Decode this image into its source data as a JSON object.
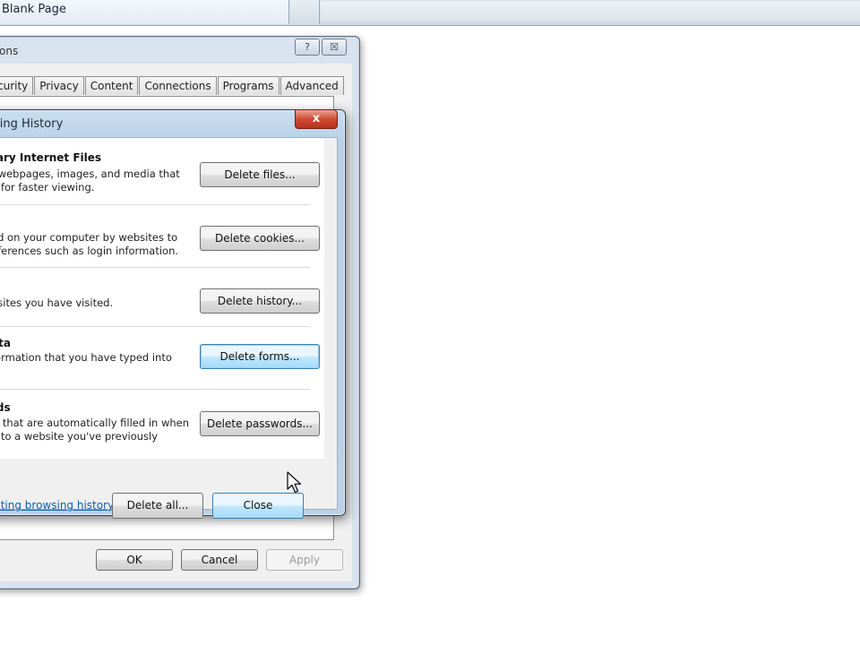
{
  "browser": {
    "active_tab_title": "Blank Page"
  },
  "internet_options": {
    "title": "ons",
    "help_button": "?",
    "close_button": "☒",
    "tabs": [
      "curity",
      "Privacy",
      "Content",
      "Connections",
      "Programs",
      "Advanced"
    ],
    "buttons": {
      "ok": "OK",
      "cancel": "Cancel",
      "apply": "Apply"
    }
  },
  "delete_history": {
    "title": "sing History",
    "close_button": "x",
    "sections": [
      {
        "title": "rary Internet Files",
        "desc_lines": [
          "f webpages, images, and media that",
          "d for faster viewing."
        ],
        "button": "Delete files..."
      },
      {
        "title": "",
        "desc_lines": [
          "ed on your computer by websites to",
          "eferences such as login information."
        ],
        "button": "Delete cookies..."
      },
      {
        "title": "",
        "desc_lines": [
          "bsites you have visited."
        ],
        "button": "Delete history..."
      },
      {
        "title": "ata",
        "desc_lines": [
          "formation that you have typed into"
        ],
        "button": "Delete forms..."
      },
      {
        "title": "rds",
        "desc_lines": [
          "ls that are automatically filled in when",
          "n to a website you've previously"
        ],
        "button": "Delete passwords..."
      }
    ],
    "help_link": "leting browsing history",
    "delete_all": "Delete all...",
    "close": "Close"
  }
}
